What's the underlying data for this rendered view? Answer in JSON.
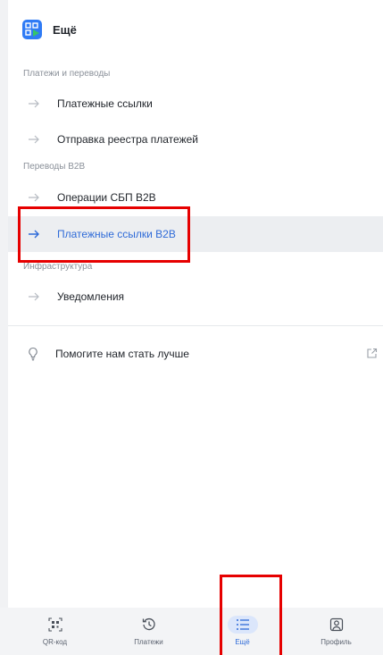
{
  "header": {
    "title": "Ещё",
    "logo_icon": "qr-app-icon"
  },
  "sections": [
    {
      "label": "Платежи и переводы",
      "items": [
        {
          "label": "Платежные ссылки"
        },
        {
          "label": "Отправка реестра платежей"
        }
      ]
    },
    {
      "label": "Переводы B2B",
      "items": [
        {
          "label": "Операции СБП B2B"
        },
        {
          "label": "Платежные ссылки B2B",
          "active": true
        }
      ]
    },
    {
      "label": "Инфраструктура",
      "items": [
        {
          "label": "Уведомления"
        }
      ]
    }
  ],
  "feedback": {
    "label": "Помогите нам стать лучше",
    "icon": "lightbulb-icon",
    "trailing_icon": "external-link-icon"
  },
  "tabbar": [
    {
      "label": "QR-код",
      "icon": "qr-code-icon"
    },
    {
      "label": "Платежи",
      "icon": "history-icon"
    },
    {
      "label": "Ещё",
      "icon": "list-icon",
      "active": true
    },
    {
      "label": "Профиль",
      "icon": "profile-icon"
    }
  ],
  "colors": {
    "accent": "#2f6bd8",
    "highlight": "#e60000",
    "active_bg": "#eceef1",
    "logo": "#2f7bf5"
  }
}
